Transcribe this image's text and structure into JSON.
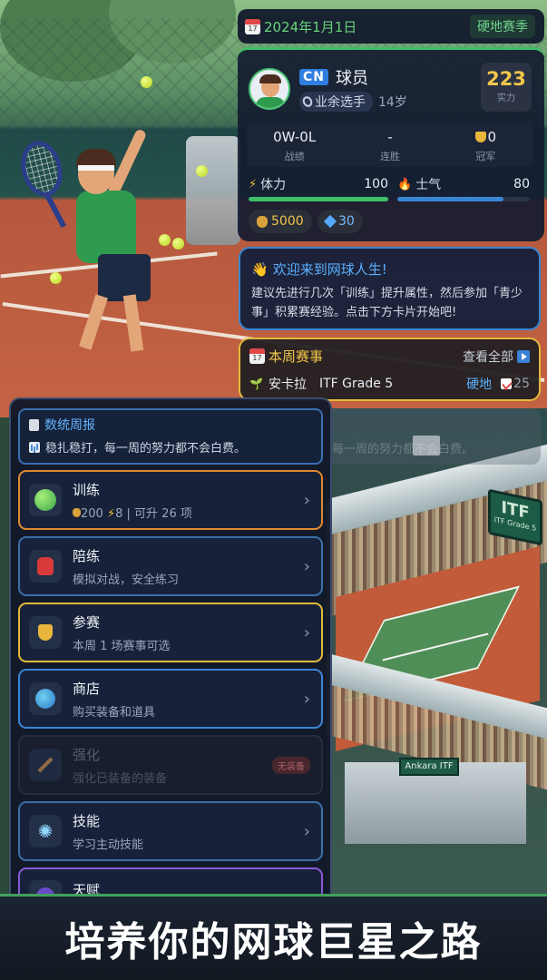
{
  "header": {
    "date": "2024年1月1日",
    "season": "硬地赛季"
  },
  "player": {
    "flag": "CN",
    "name": "球员",
    "level": "业余选手",
    "age": "14岁",
    "power_value": "223",
    "power_label": "实力",
    "record_value": "0W-0L",
    "record_label": "战绩",
    "streak_value": "-",
    "streak_label": "连胜",
    "titles_value": "0",
    "titles_label": "冠军",
    "stamina_label": "体力",
    "stamina_value": "100",
    "stamina_fraction": 1.0,
    "morale_label": "士气",
    "morale_value": "80",
    "morale_fraction": 0.8,
    "coins": "5000",
    "gems": "30"
  },
  "welcome": {
    "title": "欢迎来到网球人生!",
    "text": "建议先进行几次「训练」提升属性，然后参加「青少事」积累赛经验。点击下方卡片开始吧!"
  },
  "weekly": {
    "title": "本周赛事",
    "view_all": "查看全部",
    "event_city": "安卡拉",
    "event_grade": "ITF Grade 5",
    "event_surface": "硬地",
    "event_points": "25"
  },
  "ghost": {
    "text": "每一周的努力都不会白费。"
  },
  "report": {
    "title": "数统周报",
    "text": "稳扎稳打，每一周的努力都不会白费。"
  },
  "menu": {
    "train": {
      "title": "训练",
      "coins": "200",
      "energy": "8",
      "sub_rest": "| 可升 26 项"
    },
    "sparring": {
      "title": "陪练",
      "sub": "模拟对战，安全练习"
    },
    "compete": {
      "title": "参赛",
      "sub": "本周 1 场赛事可选"
    },
    "shop": {
      "title": "商店",
      "sub": "购买装备和道具"
    },
    "enhance": {
      "title": "强化",
      "sub": "强化已装备的装备",
      "badge": "无装备"
    },
    "skills": {
      "title": "技能",
      "sub": "学习主动技能"
    },
    "talent": {
      "title": "天赋"
    }
  },
  "stadium": {
    "board_main": "ITF",
    "board_sub": "ITF Grade 5",
    "sign": "Ankara ITF"
  },
  "banner": {
    "text": "培养你的网球巨星之路"
  },
  "colors": {
    "accent_green": "#3fbf6a",
    "accent_blue": "#3a86d4",
    "accent_gold": "#e3b93a",
    "stamina_bar": "#3fbf6a",
    "morale_bar": "#3a86d4"
  }
}
